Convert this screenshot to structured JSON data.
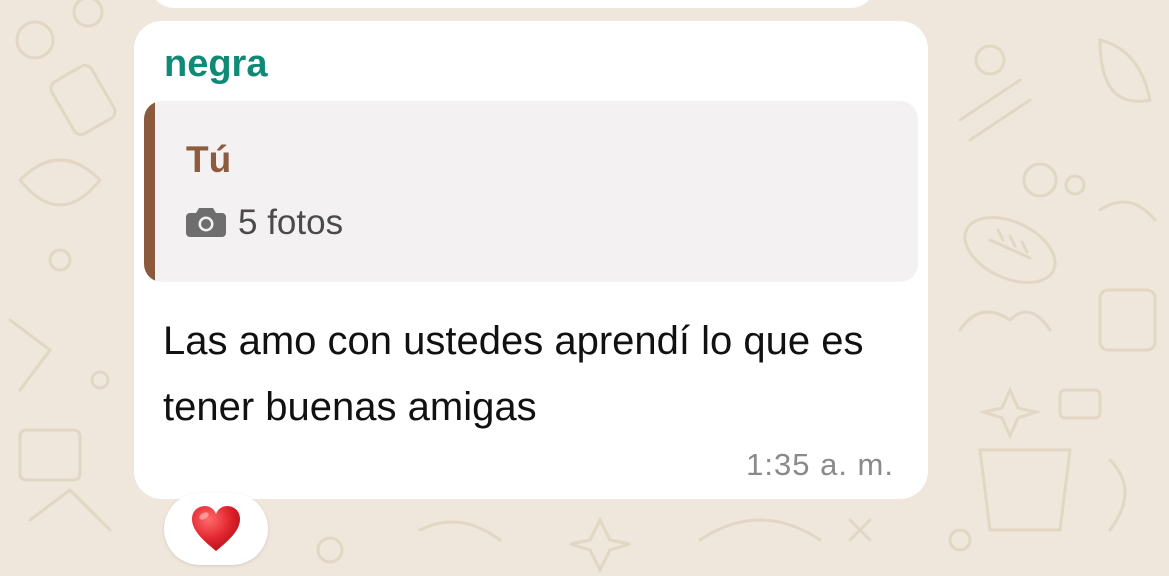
{
  "chat": {
    "sender": "negra",
    "quote": {
      "author": "Tú",
      "icon": "camera-icon",
      "text": "5 fotos"
    },
    "message": "Las amo con ustedes aprendí lo que es tener buenas amigas",
    "time": "1:35 a. m."
  },
  "reaction": {
    "icon": "red-heart-icon"
  },
  "colors": {
    "background": "#efe7dc",
    "bubble": "#ffffff",
    "sender": "#0e8a76",
    "quote_author": "#8d5c3e",
    "quote_bar": "#8b5a3c",
    "quote_bg": "#f3f1f1",
    "heart": "#e0242d"
  }
}
